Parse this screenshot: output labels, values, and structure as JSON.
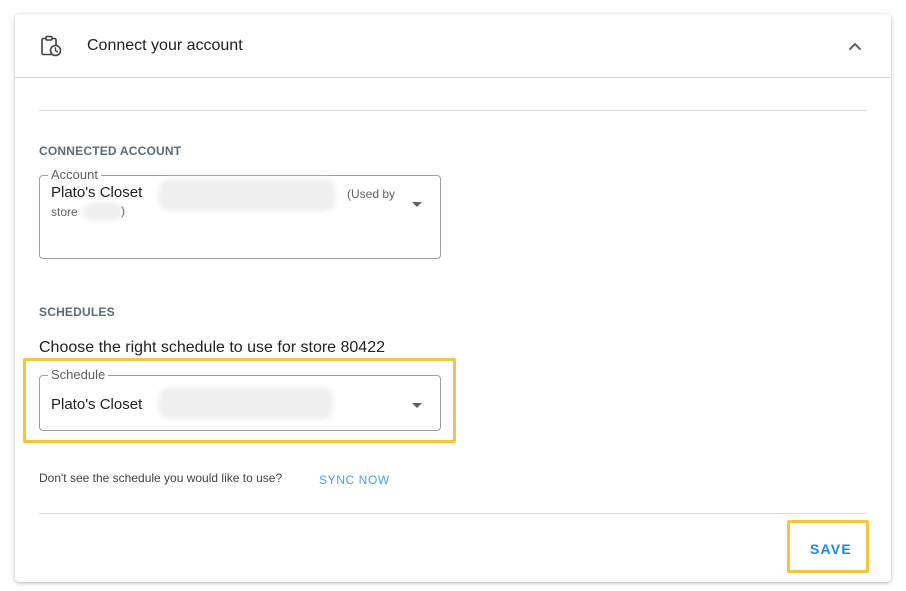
{
  "header": {
    "title": "Connect your account",
    "icon": "clipboard-clock-icon",
    "collapse_icon": "chevron-up-icon"
  },
  "connected_account": {
    "section_label": "CONNECTED ACCOUNT",
    "field_label": "Account",
    "value": "Plato's Closet",
    "used_by_prefix": "(Used by",
    "store_prefix": "store",
    "close_paren": ")"
  },
  "schedules": {
    "section_label": "SCHEDULES",
    "prompt": "Choose the right schedule to use for store 80422",
    "field_label": "Schedule",
    "value": "Plato's Closet"
  },
  "sync": {
    "help_text": "Don't see the schedule you would like to use?",
    "link_label": "SYNC NOW"
  },
  "actions": {
    "save_label": "SAVE"
  },
  "colors": {
    "accent": "#1e88e5",
    "link": "#4aa3e8",
    "highlight": "#f5c542",
    "section_label": "#5b6b78"
  }
}
